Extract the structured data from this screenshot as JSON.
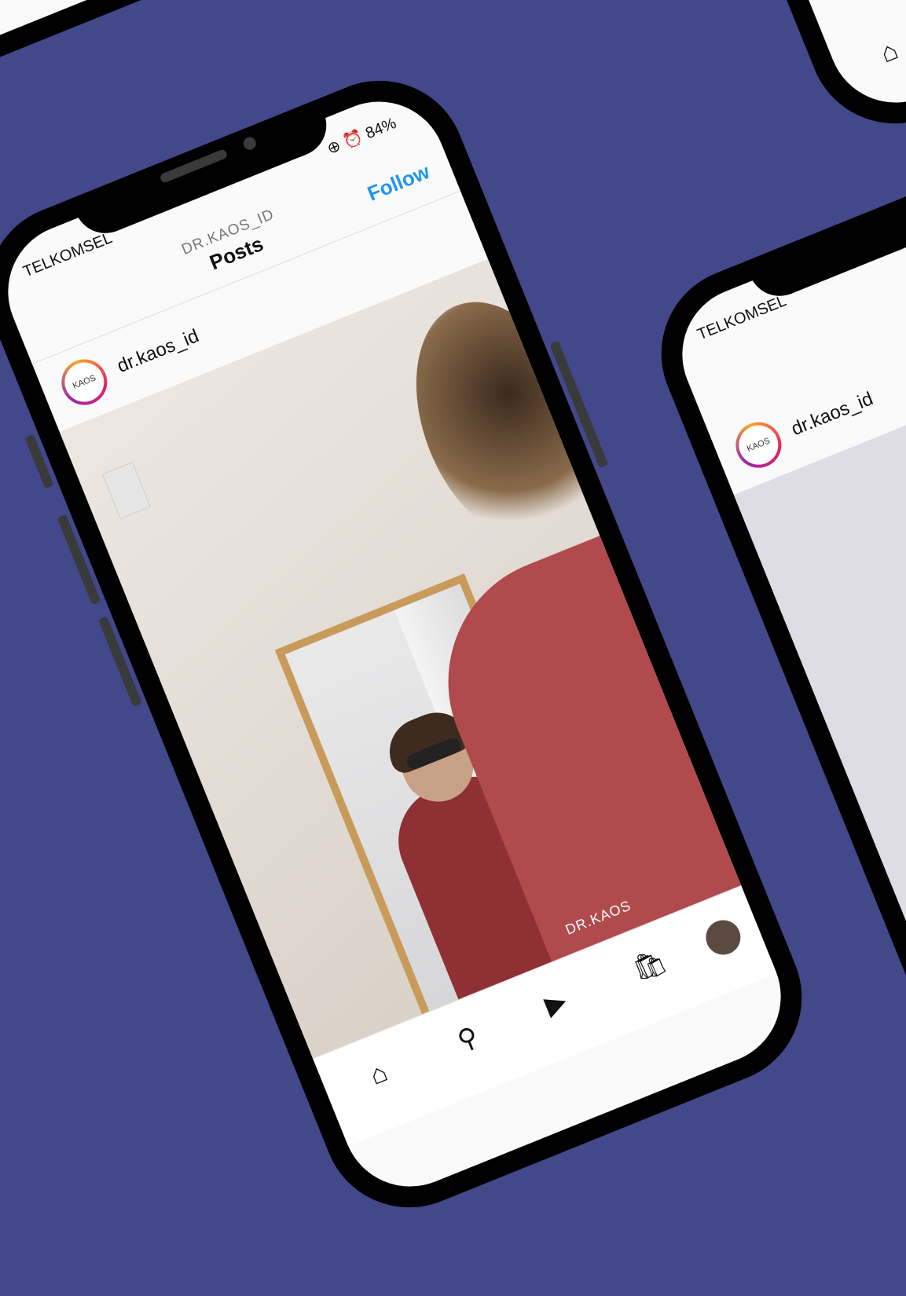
{
  "status": {
    "carrier": "TELKOMSEL",
    "battery": "84%"
  },
  "header": {
    "handle": "DR.KAOS_ID",
    "title": "Posts",
    "follow": "Follow"
  },
  "post": {
    "username": "dr.kaos_id",
    "avatar_text": "KAOS",
    "watermark": "DR.KAOS"
  },
  "side": {
    "carrier": "TELKOMSEL",
    "username": "dr.kaos_id"
  },
  "nav": {
    "home": "⌂",
    "search": "⚲",
    "shop": "🛍",
    "reels": "▶"
  },
  "colors": {
    "background": "#42488a",
    "accent": "#2196f3"
  }
}
